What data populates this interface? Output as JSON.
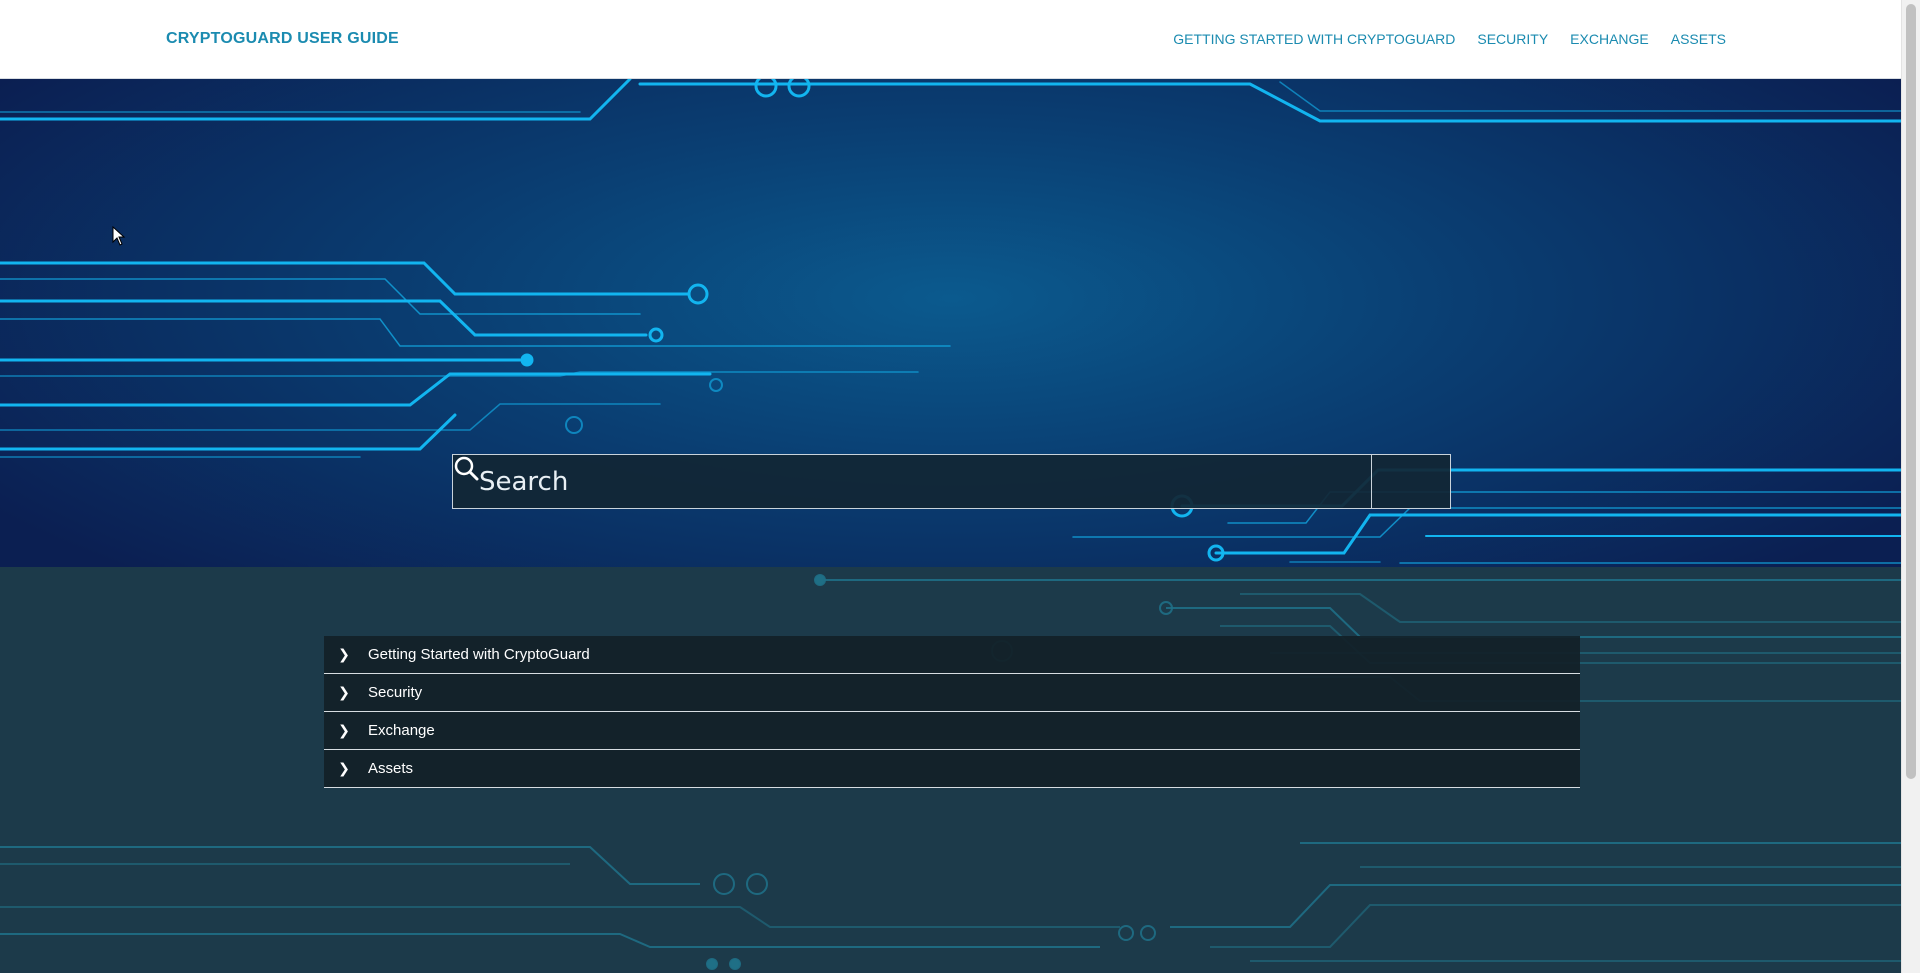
{
  "header": {
    "brand": "CRYPTOGUARD USER GUIDE",
    "nav": [
      {
        "label": "GETTING STARTED WITH CRYPTOGUARD"
      },
      {
        "label": "SECURITY"
      },
      {
        "label": "EXCHANGE"
      },
      {
        "label": "ASSETS"
      }
    ]
  },
  "search": {
    "placeholder": "Search",
    "button_icon": "search-icon"
  },
  "accordion": {
    "items": [
      {
        "label": "Getting Started with CryptoGuard",
        "icon": "chevron-right-icon"
      },
      {
        "label": "Security",
        "icon": "chevron-right-icon"
      },
      {
        "label": "Exchange",
        "icon": "chevron-right-icon"
      },
      {
        "label": "Assets",
        "icon": "chevron-right-icon"
      }
    ]
  },
  "colors": {
    "brand": "#1b8bb0",
    "hero_bg": "#0a3e72",
    "circuit": "#12b5f0",
    "lower_bg": "#1c3a4a"
  }
}
